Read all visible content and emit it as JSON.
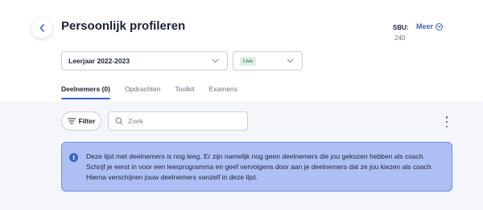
{
  "header": {
    "title": "Persoonlijk profileren",
    "sbu_label": "SBU:",
    "sbu_value": "240",
    "more_label": "Meer"
  },
  "filters": {
    "year_select": "Leerjaar 2022-2023",
    "status_badge": "Live"
  },
  "tabs": [
    {
      "label": "Deelnemers (0)",
      "active": true
    },
    {
      "label": "Opdrachten",
      "active": false
    },
    {
      "label": "Toolkit",
      "active": false
    },
    {
      "label": "Examens",
      "active": false
    }
  ],
  "toolbar": {
    "filter_label": "Filter",
    "search_placeholder": "Zoek"
  },
  "info_banner": {
    "text": "Deze lijst met deelnemers is nog leeg. Er zijn namelijk nog geen deelnemers die jou gekozen hebben als coach. Schrijf je eerst in voor een leerprogramma en geef vervolgens door aan je deelnemers dat ze jou kiezen als coach. Hierna verschijnen jouw deelnemers vanzelf in deze lijst."
  },
  "icons": {
    "back": "chevron-left-icon",
    "more": "chevron-circle-down-icon",
    "select": "chevron-down-icon",
    "filter": "filter-lines-icon",
    "search": "search-icon",
    "menu": "kebab-menu-icon",
    "info": "info-icon"
  },
  "colors": {
    "accent": "#3a63c9",
    "banner_bg": "#aebff3",
    "banner_border": "#6f8ddf",
    "live_badge_bg": "#dcefe5"
  }
}
